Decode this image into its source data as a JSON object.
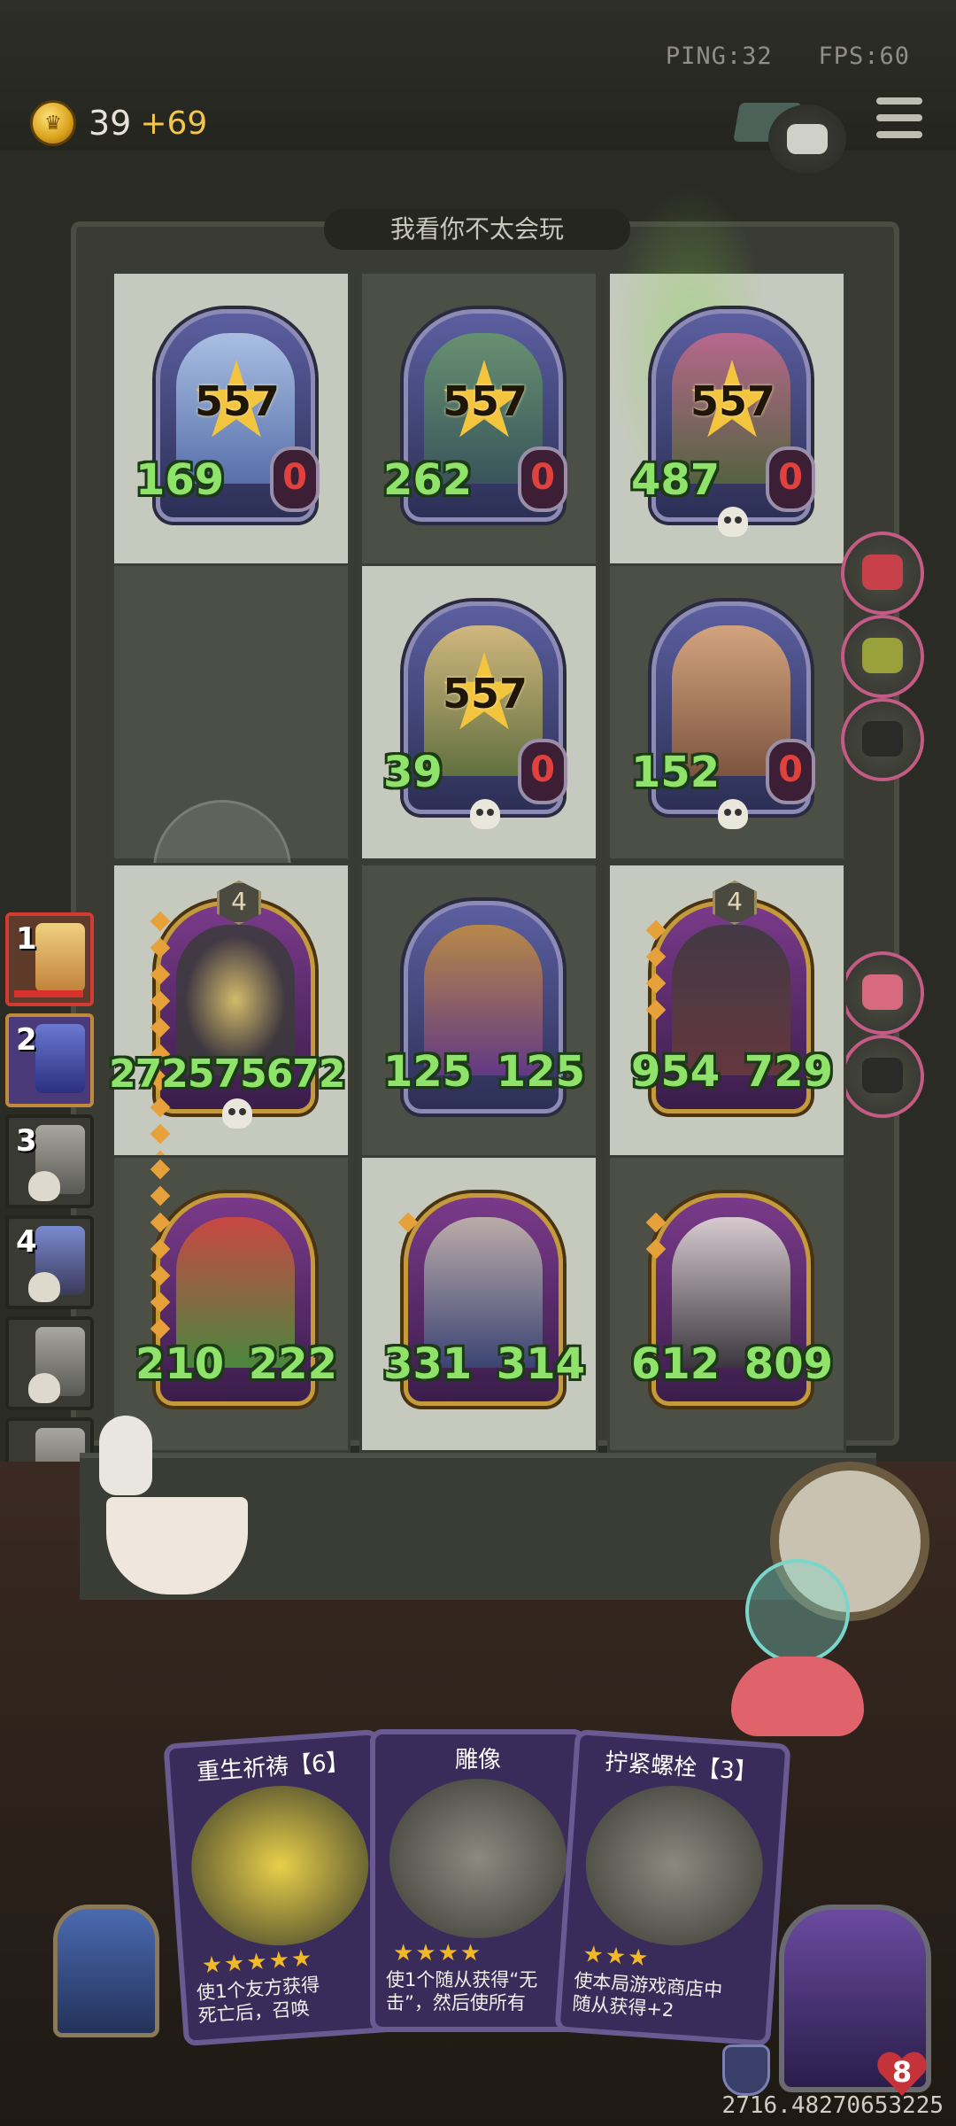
{
  "status": {
    "ping": "PING:32",
    "fps": "FPS:60"
  },
  "gold": {
    "amount": "39",
    "increment": "+69"
  },
  "opponent_name": "我看你不太会玩",
  "opponent_board": [
    {
      "star": "557",
      "attack": "169",
      "shield": "0"
    },
    {
      "star": "557",
      "attack": "262",
      "shield": "0"
    },
    {
      "star": "557",
      "attack": "487",
      "shield": "0"
    },
    {
      "star": "557",
      "attack": "39",
      "shield": "0"
    },
    {
      "attack": "152",
      "shield": "0"
    }
  ],
  "player_board": [
    {
      "tier": "4",
      "attack": "272",
      "hp": "575672",
      "display": "272575672"
    },
    {
      "attack": "125",
      "hp": "125"
    },
    {
      "tier": "4",
      "attack": "954",
      "hp": "729"
    },
    {
      "attack": "210",
      "hp": "222"
    },
    {
      "attack": "331",
      "hp": "314"
    },
    {
      "attack": "612",
      "hp": "809"
    }
  ],
  "leaderboard": [
    {
      "rank": "1"
    },
    {
      "rank": "2"
    },
    {
      "rank": "3"
    },
    {
      "rank": "4"
    },
    {
      "rank": ""
    },
    {
      "rank": ""
    },
    {
      "rank": ""
    },
    {
      "rank": ""
    }
  ],
  "cards": [
    {
      "title": "重生祈祷【6】",
      "stars": "★★★★★",
      "desc1": "使1个友方获得",
      "desc2": "死亡后，召唤"
    },
    {
      "title": "雕像",
      "stars": "★★★★",
      "desc1": "使1个随从获得“无",
      "desc2": "击”，然后使所有"
    },
    {
      "title": "拧紧螺栓【3】",
      "stars": "★★★",
      "desc1": "使本局游戏商店中",
      "desc2": "随从获得+2"
    }
  ],
  "hero_hp": "8",
  "coords": "2716.48270653225",
  "colors": {
    "accent_gold": "#f2c54c",
    "stat_green": "#8fe26a",
    "shield_red": "#e0413c",
    "card_purple": "#3a2c5a"
  },
  "icons": [
    "coin-icon",
    "chat-icon",
    "menu-icon",
    "book-icon",
    "skull-icon",
    "armor-icon",
    "heart-icon"
  ]
}
